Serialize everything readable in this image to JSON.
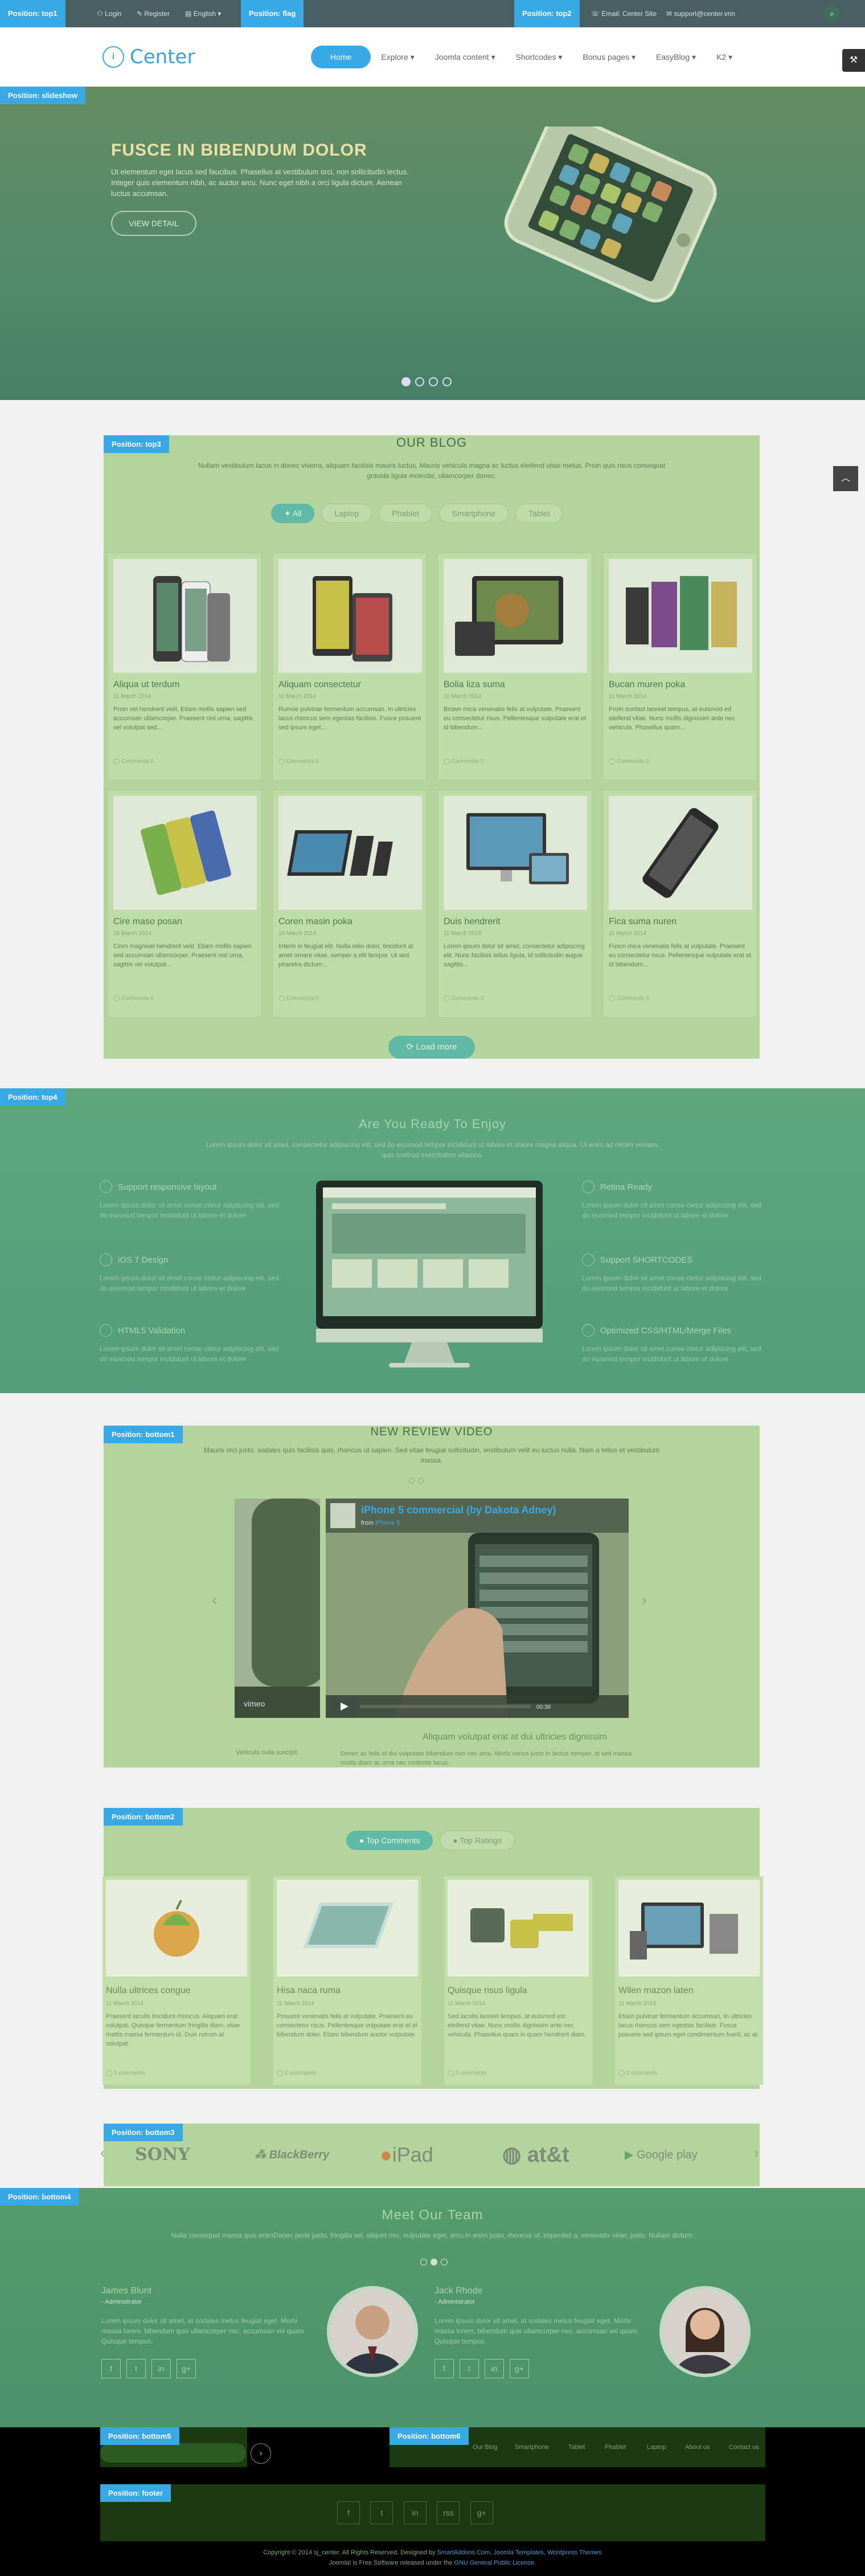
{
  "badges": {
    "top1": "Position: top1",
    "top2": "Position: top2",
    "flag": "Position: flag",
    "slideshow": "Position: slideshow",
    "top3": "Position: top3",
    "top4": "Position: top4",
    "bottom1": "Position: bottom1",
    "bottom2": "Position: bottom2",
    "bottom3": "Position: bottom3",
    "bottom4": "Position: bottom4",
    "bottom5": "Position: bottom5",
    "bottom6": "Position: bottom6",
    "footer": "Position: footer"
  },
  "topbar": {
    "login": "Login",
    "register": "Register",
    "language": "English",
    "email_text": "Email: Center Site",
    "email_address": "support@center.vnn"
  },
  "header": {
    "logo_mark": "i",
    "logo_text": "Center",
    "nav": [
      "Home",
      "Explore",
      "Joomla content",
      "Shortcodes",
      "Bonus pages",
      "EasyBlog",
      "K2"
    ]
  },
  "slider": {
    "title": "FUSCE IN BIBENDUM DOLOR",
    "text": "Ut elementum eget lacus sed faucibus. Phasellus at vestibulum orci, non sollicitudin lectus. Integer quis elementum nibh, ac auctor arcu. Nunc eget nibh a orci ligula dictum. Aenean luctus accumsan.",
    "button": "VIEW DETAIL"
  },
  "blog": {
    "title": "OUR BLOG",
    "subtitle": "Nullam vestibulum lacus in donec viverra, aliquam facilisis mauris luctus. Mauris vehicula magna ac luctus eleifend vitae metus. Proin quis risus consequat gravida ligula molestie, ullamcorper donec.",
    "filters": [
      "All",
      "Laptop",
      "Phablet",
      "Smartphone",
      "Tablet"
    ],
    "posts": [
      {
        "title": "Aliqua ut terdum",
        "date": "11 March 2014",
        "text": "Proin vel hendrerit velit. Etiam mollis sapien sed accumsan ullamcorper. Praesent nisl urna, sagittis vel volutpat sed...",
        "comments": "Comments 0"
      },
      {
        "title": "Aliquam consectetur",
        "date": "11 March 2014",
        "text": "Rumoe pulvinar fermentum accumsan. In ultricies lacus rhoncus sem egestas facilisis. Fusce posuere sed ipsum eget...",
        "comments": "Comments 0"
      },
      {
        "title": "Bolia liza suma",
        "date": "11 March 2014",
        "text": "Brown mica venenatis felis at vulputate. Praesent eu consectetur risus. Pellentesque vulputate erat et id bibendum...",
        "comments": "Comments 0"
      },
      {
        "title": "Bucan muren poka",
        "date": "11 March 2014",
        "text": "Proin sunfast laoreet tempus, at euismod ed eleifend vitae. Nunc mollis dignissim ante nec vehicula. Phasellus quam...",
        "comments": "Comments 0"
      },
      {
        "title": "Cire maso posan",
        "date": "18 March 2014",
        "text": "Cinm magnivel hendrerit velit. Etiam mollis sapien sed accumsan ullamcorper. Praesent nisl urna, sagittis vel volutpat...",
        "comments": "Comments 0"
      },
      {
        "title": "Coren masin poka",
        "date": "10 March 2014",
        "text": "Interin in feugiat elit. Nulla odio dolor, tincidunt at amet ornare vitae, semper a elit tempor. Ut sed pharetra dictum...",
        "comments": "Comments 0"
      },
      {
        "title": "Duis hendrerit",
        "date": "11 March 2014",
        "text": "Lorem ipsum dolor sit amet, consectetur adipiscing elit. Nunc facilisis tellus ligula, id sollicitudin augue sagittis...",
        "comments": "Comments 0"
      },
      {
        "title": "Fica suma nuren",
        "date": "11 March 2014",
        "text": "Fuscn mica venenatis felis at vulputate. Praesent eu consectetur risus. Pellentesque vulputate erat et id bibendum...",
        "comments": "Comments 0"
      }
    ],
    "load_more": "Load more"
  },
  "top4": {
    "title": "Are You Ready To Enjoy",
    "subtitle": "Lorem ipsum dolor sit amet, consectetur adipiscing elit, sed do eiusmod tempor incididunt ut labore et dolore magna aliqua. Ut enim ad minim veniam, quis nostrud exercitation ullamco.",
    "features_left": [
      {
        "title": "Support responsive layout",
        "text": "Lorem ipsum dolor sit amet conse ctetur adipiscing elit, sed do eiusmod tempor incididunt ut labore et dolore"
      },
      {
        "title": "iOS 7 Design",
        "text": "Lorem ipsum dolor sit amet conse ctetur adipiscing elit, sed do eiusmod tempor incididunt ut labore et dolore"
      },
      {
        "title": "HTML5 Validation",
        "text": "Lorem ipsum dolor sit amet conse ctetur adipiscing elit, sed do eiusmod tempor incididunt ut labore et dolore"
      }
    ],
    "features_right": [
      {
        "title": "Retina Ready",
        "text": "Lorem ipsum dolor sit amet conse ctetur adipiscing elit, sed do eiusmod tempor incididunt ut labore et dolore"
      },
      {
        "title": "Support SHORTCODES",
        "text": "Lorem ipsum dolor sit amet conse ctetur adipiscing elit, sed do eiusmod tempor incididunt ut labore et dolore"
      },
      {
        "title": "Optimized CSS/HTML/Merge Files",
        "text": "Lorem ipsum dolor sit amet conse ctetur adipiscing elit, sed do eiusmod tempor incididunt ut labore et dolore"
      }
    ]
  },
  "video": {
    "title": "NEW REVIEW VIDEO",
    "subtitle": "Mauris orci justo, sodales quis facilisis quis, rhoncus ut sapien. Sed vitae feugiat sollicitudin, vestibulum velit eu luctus nulla. Nam a tellus et vestibulum massa.",
    "player_title": "iPhone 5 commercial (by Dakota Adney)",
    "player_from": "from",
    "player_user": "iPhone 5",
    "player_time": "00:38",
    "player_brand": "vimeo",
    "caption_title": "Aliquam volutpat erat at dui ultricies dignissim",
    "caption_left": "Vehicula nulla suscipit.",
    "caption_text": "Donec ac felis et dui vulputate bibendum non nec arcu. Morbi varius justo in lectus semper, at sed massa mollis diam ac urna nec molestie lacus."
  },
  "bottom2": {
    "tabs": [
      "Top Comments",
      "Top Ratings"
    ],
    "posts": [
      {
        "title": "Nulla ultrices congue",
        "date": "11 March 2014",
        "text": "Praesent iaculis tincidunt rhoncus. Aliquam erat volutpat. Quisque fermentum fringilla diam, vitae mattis massa fermentum id. Duis rutrum at volutpat.",
        "comments": "5 comments"
      },
      {
        "title": "Hisa naca ruma",
        "date": "11 March 2014",
        "text": "Posuere venenatis felis at vulputate. Praesent eu consectetur risus. Pellentesque vulputate erat et id bibendum dolor. Etiam bibendum auctor vulputate.",
        "comments": "2 comments"
      },
      {
        "title": "Quisque risus ligula",
        "date": "11 March 2014",
        "text": "Sed iaculis laoreet tempus, at euismod est eleifend vitae. Nunc mollis dignissim ante nec vehicula. Phasellus quam in quam hendrerit diam.",
        "comments": "2 comments"
      },
      {
        "title": "Wilen mazon laten",
        "date": "11 March 2014",
        "text": "Etiam pulvinar fermentum accumsan. In ultricies lacus rhoncus sem egestas facilisis. Fusce posuere sed ipsum eget condimentum fuerit, ac at.",
        "comments": "2 comments"
      }
    ]
  },
  "brands": [
    "SONY",
    "BlackBerry",
    "iPad",
    "at&t",
    "Google play"
  ],
  "team": {
    "title": "Meet Our Team",
    "subtitle": "Nulla consequat massa quis enimDonec pede justo, fringilla vel, aliquet nec, vulputate eget, arcu.In enim justo, rhoncus ut, imperdiet a, venenatis vitae, justo. Nullam dictum.",
    "members": [
      {
        "name": "James Blunt",
        "role": "- Administrator",
        "bio": "Lorem ipsum dolor sit amet, at sodales metus feugiat eget. Morbi massa lorem, bibendum quis ullamcorper nec, accumsan vel quam. Quisque tempus."
      },
      {
        "name": "Jack Rhode",
        "role": "- Administrator",
        "bio": "Lorem ipsum dolor sit amet, at sodales metus feugiat eget. Morbi massa lorem, bibendum quis ullamcorper nec, accumsan vel quam. Quisque tempus."
      }
    ],
    "social_icons": [
      "f",
      "t",
      "in",
      "g+"
    ]
  },
  "footer": {
    "menu": [
      "Our Blog",
      "Smartphone",
      "Tablet",
      "Phablet",
      "Laptop",
      "About us",
      "Contact us"
    ],
    "social_icons": [
      "f",
      "t",
      "in",
      "rss",
      "g+"
    ],
    "copyright": "Copyright © 2014 sj_center. All Rights Reserved. Designed by",
    "designer": "SmartAddons.Com",
    "templates": "Joomla Templates",
    "themes": "Wordpress Themes",
    "license_prefix": "Joomla! is Free Software released under the",
    "license": "GNU General Public License."
  },
  "colors": {
    "accent": "#39a9e6",
    "tint": "#b3d49b",
    "teal_button": "#5fb9a4"
  }
}
